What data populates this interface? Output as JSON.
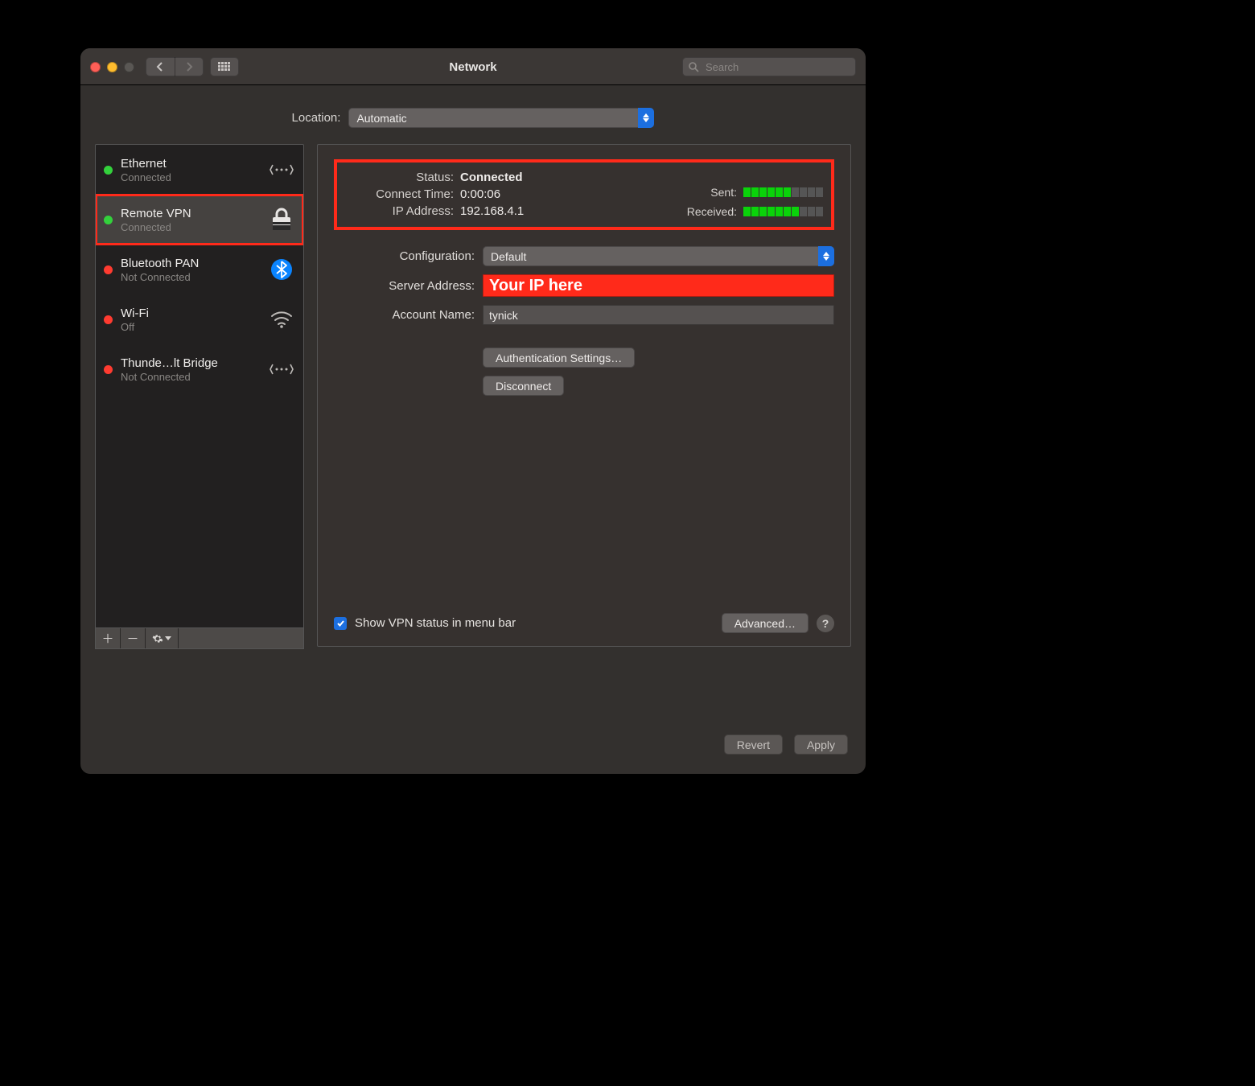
{
  "window": {
    "title": "Network",
    "search_placeholder": "Search"
  },
  "location": {
    "label": "Location:",
    "value": "Automatic"
  },
  "sidebar": {
    "items": [
      {
        "name": "Ethernet",
        "sub": "Connected",
        "dot": "green",
        "icon": "dots-sync-icon"
      },
      {
        "name": "Remote VPN",
        "sub": "Connected",
        "dot": "green",
        "icon": "lock-icon",
        "selected": true,
        "highlighted": true
      },
      {
        "name": "Bluetooth PAN",
        "sub": "Not Connected",
        "dot": "red",
        "icon": "bluetooth-icon"
      },
      {
        "name": "Wi-Fi",
        "sub": "Off",
        "dot": "red",
        "icon": "wifi-icon"
      },
      {
        "name": "Thunde…lt Bridge",
        "sub": "Not Connected",
        "dot": "red",
        "icon": "dots-sync-icon"
      }
    ]
  },
  "detail": {
    "status_label": "Status:",
    "status_value": "Connected",
    "connect_time_label": "Connect Time:",
    "connect_time_value": "0:00:06",
    "ip_label": "IP Address:",
    "ip_value": "192.168.4.1",
    "sent_label": "Sent:",
    "received_label": "Received:",
    "sent_level": 6,
    "received_level": 7,
    "meter_total": 10,
    "config_label": "Configuration:",
    "config_value": "Default",
    "server_label": "Server Address:",
    "server_value": "Your IP here",
    "account_label": "Account Name:",
    "account_value": "tynick",
    "auth_button": "Authentication Settings…",
    "disconnect_button": "Disconnect",
    "show_status_label": "Show VPN status in menu bar",
    "advanced_button": "Advanced…"
  },
  "footer": {
    "revert": "Revert",
    "apply": "Apply"
  }
}
